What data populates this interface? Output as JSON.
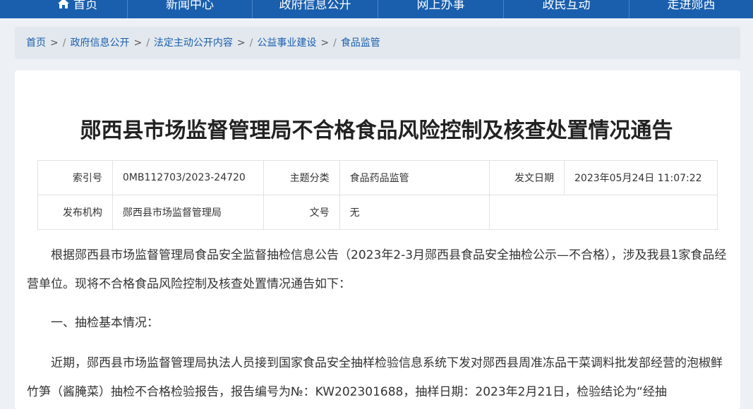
{
  "nav": {
    "items": [
      "首页",
      "新闻中心",
      "政府信息公开",
      "网上办事",
      "政民互动",
      "走进郧西"
    ]
  },
  "breadcrumb": {
    "items": [
      "首页",
      "政府信息公开",
      "法定主动公开内容",
      "公益事业建设",
      "食品监管"
    ]
  },
  "article": {
    "title": "郧西县市场监督管理局不合格食品风险控制及核查处置情况通告",
    "meta": {
      "index_label": "索引号",
      "index_value": "0MB112703/2023-24720",
      "topic_label": "主题分类",
      "topic_value": "食品药品监管",
      "date_label": "发文日期",
      "date_value": "2023年05月24日 11:07:22",
      "org_label": "发布机构",
      "org_value": "郧西县市场监督管理局",
      "docno_label": "文号",
      "docno_value": "无"
    },
    "paragraphs": [
      "根据郧西县市场监督管理局食品安全监督抽检信息公告（2023年2-3月郧西县食品安全抽检公示—不合格），涉及我县1家食品经营单位。现将不合格食品风险控制及核查处置情况通告如下：",
      "一、抽检基本情况：",
      "近期，郧西县市场监督管理局执法人员接到国家食品安全抽样检验信息系统下发对郧西县周准冻品干菜调料批发部经营的泡椒鲜竹笋（酱腌菜）抽检不合格检验报告，报告编号为№：KW202301688，抽样日期：2023年2月21日，检验结论为“经抽"
    ]
  }
}
